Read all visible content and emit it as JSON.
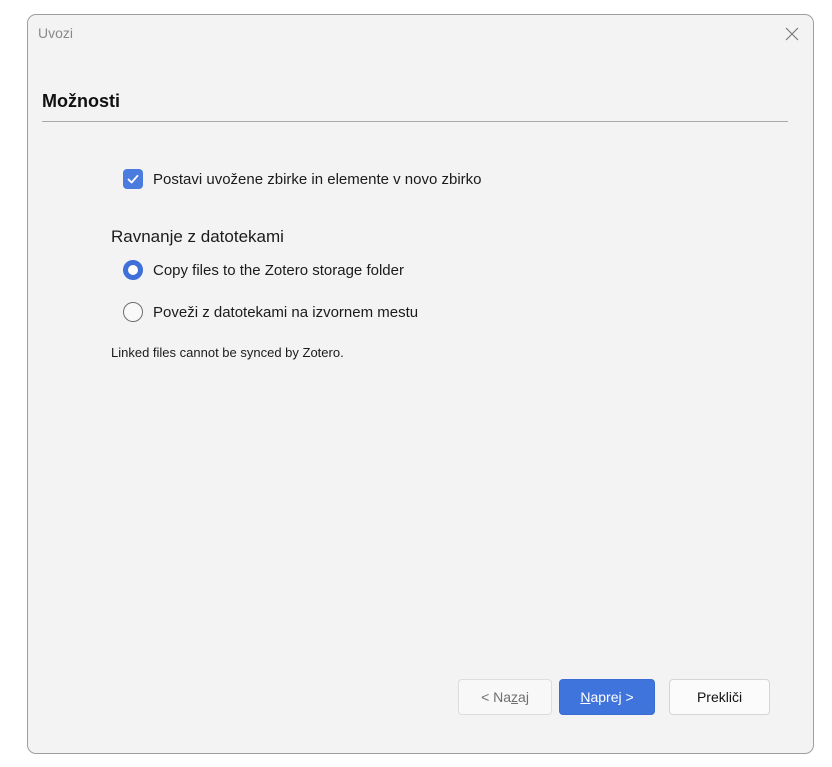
{
  "window": {
    "title": "Uvozi",
    "close_icon": "close-icon"
  },
  "main": {
    "heading": "Možnosti",
    "create_collection_checkbox": {
      "label": "Postavi uvožene zbirke in elemente v novo zbirko",
      "checked": true
    },
    "file_handling": {
      "label": "Ravnanje z datotekami",
      "options": [
        {
          "label": "Copy files to the Zotero storage folder",
          "selected": true
        },
        {
          "label": "Poveži z datotekami na izvornem mestu",
          "selected": false
        }
      ],
      "note": "Linked files cannot be synced by Zotero."
    }
  },
  "buttons": {
    "back": {
      "pre": "< Na",
      "mnemonic": "z",
      "post": "aj"
    },
    "next": {
      "pre": "",
      "mnemonic": "N",
      "post": "aprej >"
    },
    "cancel": "Prekliči"
  },
  "colors": {
    "accent": "#3f74dd",
    "window_bg": "#f3f3f3"
  }
}
